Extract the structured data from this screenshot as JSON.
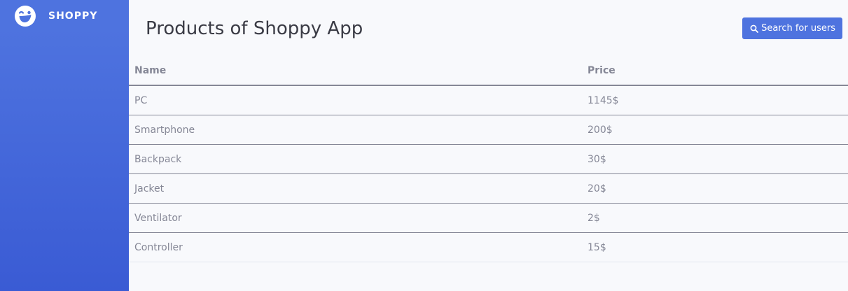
{
  "sidebar": {
    "brand_name": "SHOPPY",
    "brand_icon": "laughing-face-icon"
  },
  "header": {
    "title": "Products of Shoppy App",
    "search_button": {
      "label": "Search for users",
      "icon": "search-icon"
    }
  },
  "table": {
    "columns": [
      "Name",
      "Price"
    ],
    "rows": [
      {
        "name": "PC",
        "price": "1145$"
      },
      {
        "name": "Smartphone",
        "price": "200$"
      },
      {
        "name": "Backpack",
        "price": "30$"
      },
      {
        "name": "Jacket",
        "price": "20$"
      },
      {
        "name": "Ventilator",
        "price": "2$"
      },
      {
        "name": "Controller",
        "price": "15$"
      }
    ]
  },
  "colors": {
    "accent": "#4e73df",
    "text_dark": "#3a3b45",
    "text_muted": "#858796",
    "background": "#f8f9fc"
  }
}
